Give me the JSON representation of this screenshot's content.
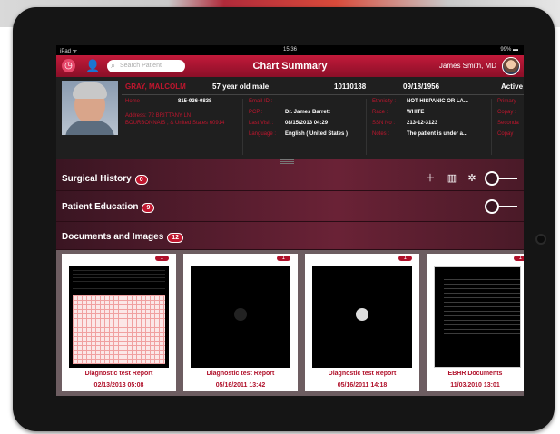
{
  "status_bar": {
    "carrier": "iPad ᯤ",
    "time": "15:36",
    "battery": "99% ▬"
  },
  "navbar": {
    "search_placeholder": "Search Patient",
    "title": "Chart Summary",
    "user": "James Smith, MD"
  },
  "patient": {
    "name": "GRAY, MALCOLM",
    "age_gender": "57 year old male",
    "id": "10110138",
    "dob": "09/18/1956",
    "status": "Active",
    "home_label": "Home :",
    "home": "815-936-0838",
    "address": "Address: 72 BRITTANY LN BOURBONNAIS , & United States 60914",
    "email_label": "Email-ID :",
    "email": "",
    "pcp_label": "PCP :",
    "pcp": "Dr. James Barrett",
    "last_visit_label": "Last Visit :",
    "last_visit": "08/15/2013 04:29",
    "language_label": "Language :",
    "language": "English ( United States )",
    "ethnicity_label": "Ethnicity :",
    "ethnicity": "NOT HISPANIC OR LA...",
    "race_label": "Race :",
    "race": "WHITE",
    "ssn_label": "SSN No :",
    "ssn": "213-12-3123",
    "notes_label": "Notes :",
    "notes": "The patient is under a...",
    "primary_label": "Primary",
    "copay_label": "Copay :",
    "second_label": "Seconda",
    "copay2_label": "Copay"
  },
  "sections": {
    "surgical": {
      "title": "Surgical History",
      "count": "0"
    },
    "education": {
      "title": "Patient Education",
      "count": "9"
    },
    "documents": {
      "title": "Documents and Images",
      "count": "12"
    }
  },
  "documents": [
    {
      "title": "Diagnostic test Report",
      "date": "02/13/2013 05:08",
      "count": "1"
    },
    {
      "title": "Diagnostic test Report",
      "date": "05/16/2011 13:42",
      "count": "1"
    },
    {
      "title": "Diagnostic test Report",
      "date": "05/16/2011 14:18",
      "count": "1"
    },
    {
      "title": "EBHR Documents",
      "date": "11/03/2010 13:01",
      "count": "1"
    }
  ]
}
